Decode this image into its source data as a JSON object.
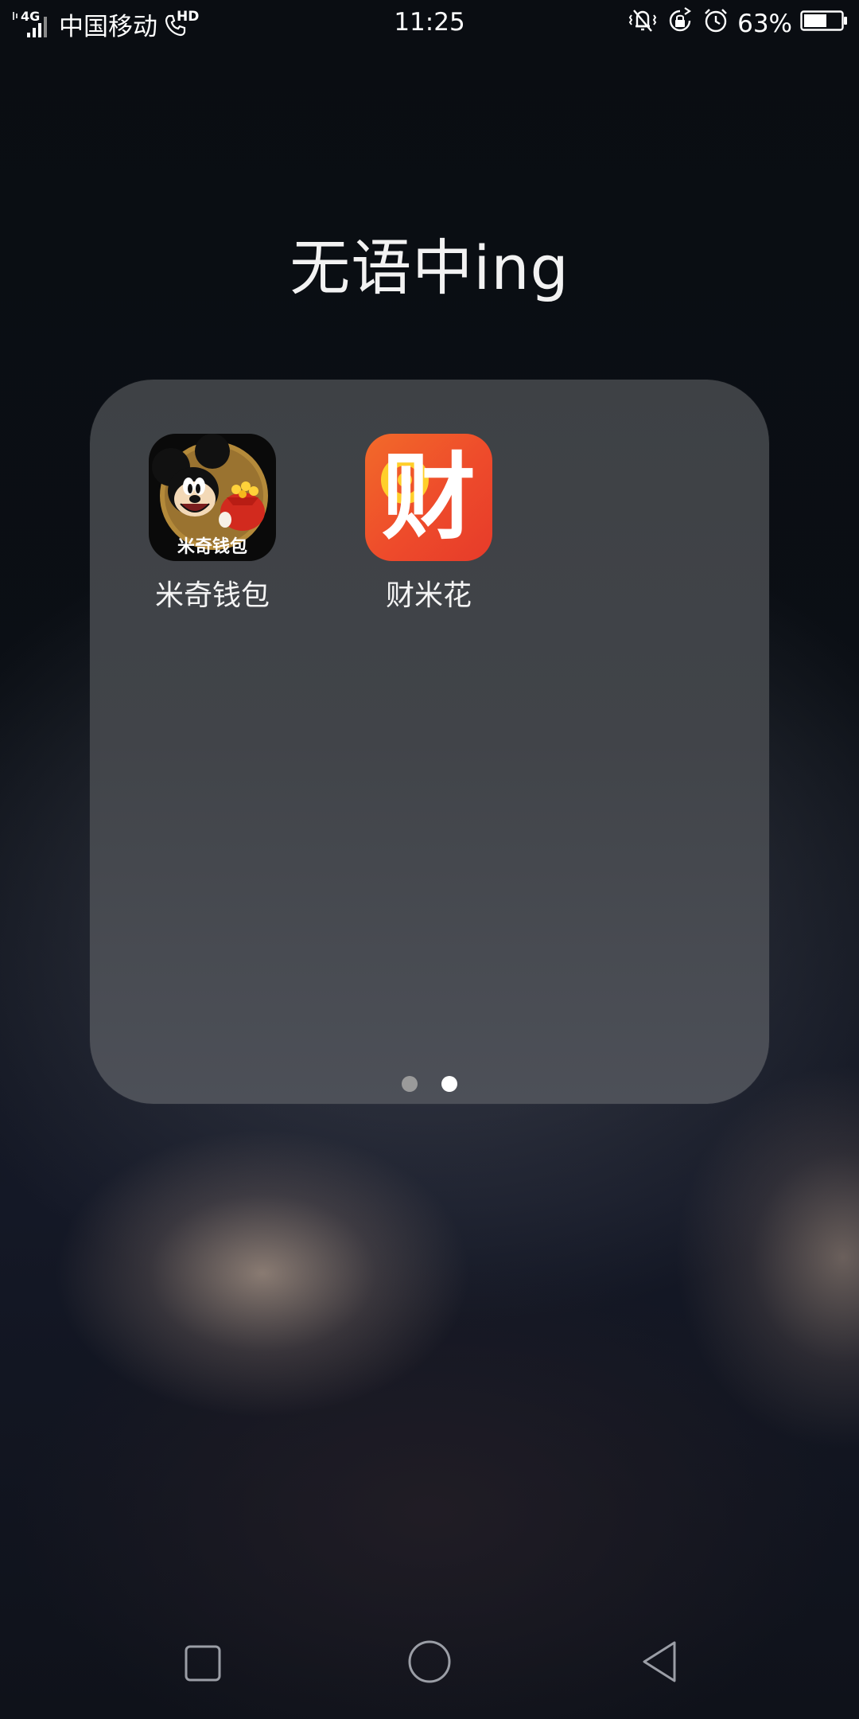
{
  "status_bar": {
    "network_type": "4G",
    "carrier": "中国移动",
    "hd_label": "HD",
    "time": "11:25",
    "battery": "63%",
    "battery_level": 0.63,
    "icons": [
      "vibrate-icon",
      "rotation-lock-icon",
      "alarm-icon",
      "battery-icon"
    ]
  },
  "folder": {
    "title": "无语中ing",
    "apps": [
      {
        "label": "米奇钱包",
        "icon_text": "米奇钱包",
        "icon": "mickey-wallet-app-icon"
      },
      {
        "label": "财米花",
        "icon_text": "财",
        "icon": "caimihua-app-icon"
      }
    ],
    "pages": {
      "total": 2,
      "current": 2
    }
  },
  "nav_bar": {
    "buttons": [
      "recent-apps",
      "home",
      "back"
    ]
  },
  "colors": {
    "caimihua_orange": "#f0502a",
    "caimihua_yellow": "#ffcf2b",
    "mickey_gold": "#b48a3a"
  }
}
